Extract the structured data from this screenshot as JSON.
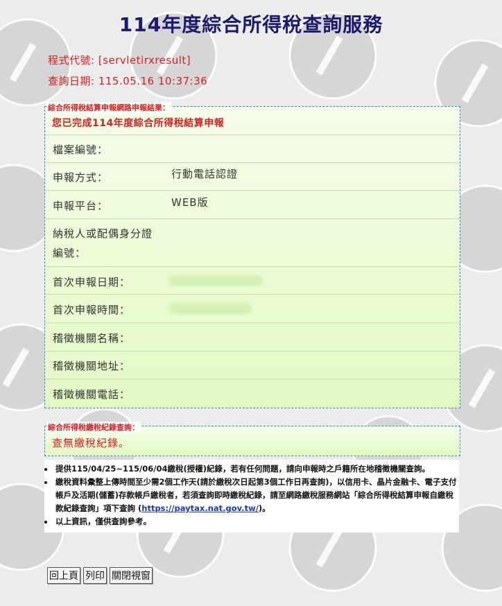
{
  "title": "114年度綜合所得稅查詢服務",
  "meta": {
    "program_code": "程式代號: [servletirxresult]",
    "query_date": "查詢日期: 115.05.16 10:37:36"
  },
  "filing": {
    "legend": "綜合所得稅結算申報網路申報結果：",
    "headline": "您已完成114年度綜合所得稅結算申報",
    "rows": [
      {
        "label": "檔案編號：",
        "value": ""
      },
      {
        "label": "申報方式：",
        "value": "行動電話認證"
      },
      {
        "label": "申報平台：",
        "value": "WEB版"
      },
      {
        "label": "納稅人或配偶身分證",
        "label2": "編號：",
        "value": ""
      },
      {
        "label": "首次申報日期：",
        "value": ""
      },
      {
        "label": "首次申報時間：",
        "value": ""
      },
      {
        "label": "稽徵機關名稱：",
        "value": ""
      },
      {
        "label": "稽徵機關地址：",
        "value": ""
      },
      {
        "label": "稽徵機關電話：",
        "value": ""
      }
    ]
  },
  "payment": {
    "legend": "綜合所得稅繳稅紀錄查詢：",
    "message": "查無繳稅紀錄。"
  },
  "notes": {
    "n1": "提供115/04/25~115/06/04繳稅(授權)紀錄，若有任何問題，請向申報時之戶籍所在地稽徵機關查詢。",
    "n2_pre": "繳稅資料彙整上傳時間至少需2個工作天(請於繳稅次日起第3個工作日再查詢)，以信用卡、晶片金融卡、電子支付帳戶及活期(儲蓄)存款帳戶繳稅者，若須查詢即時繳稅紀錄，請至網路繳稅服務網站「綜合所得稅結算申報自繳稅款紀錄查詢」項下查詢 (",
    "n2_link": "https://paytax.nat.gov.tw/",
    "n2_post": ")。",
    "n3": "以上資訊，僅供查詢參考。"
  },
  "buttons": {
    "back": "回上頁",
    "print": "列印",
    "close": "關閉視窗"
  }
}
